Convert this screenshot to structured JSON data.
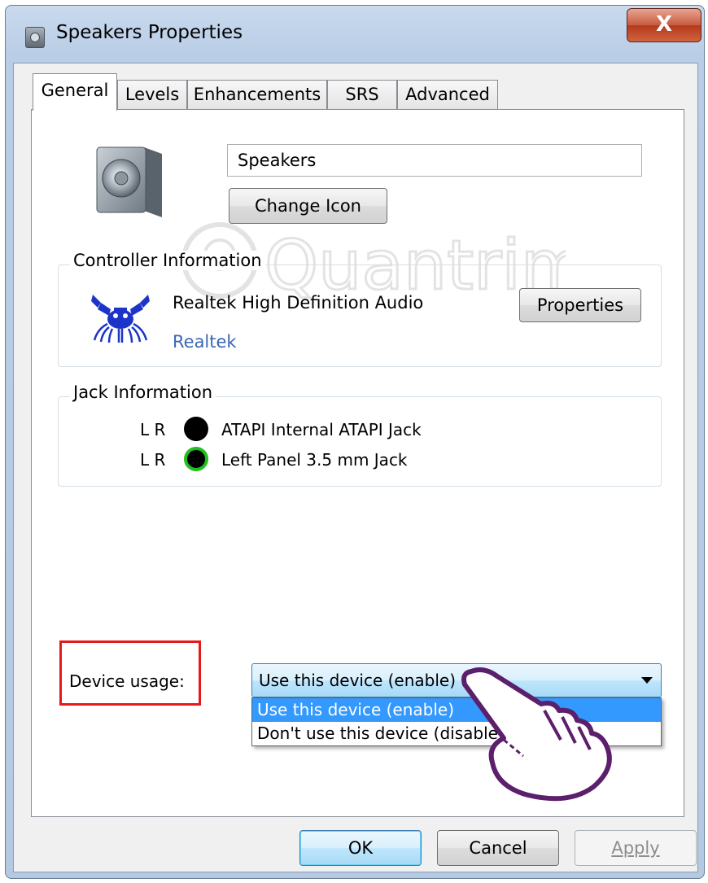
{
  "window": {
    "title": "Speakers Properties",
    "close_glyph": "X"
  },
  "tabs": [
    {
      "label": "General",
      "active": true
    },
    {
      "label": "Levels",
      "active": false
    },
    {
      "label": "Enhancements",
      "active": false
    },
    {
      "label": "SRS",
      "active": false
    },
    {
      "label": "Advanced",
      "active": false
    }
  ],
  "general": {
    "device_name": "Speakers",
    "change_icon_label": "Change Icon",
    "icon": "speaker-icon"
  },
  "controller": {
    "group_label": "Controller Information",
    "name": "Realtek High Definition Audio",
    "vendor_link": "Realtek",
    "properties_label": "Properties",
    "logo": "realtek-crab-logo"
  },
  "jack": {
    "group_label": "Jack Information",
    "items": [
      {
        "channels": "L R",
        "name": "ATAPI Internal ATAPI Jack",
        "color": "#000000"
      },
      {
        "channels": "L R",
        "name": "Left Panel 3.5 mm Jack",
        "color": "#21c021"
      }
    ]
  },
  "device_usage": {
    "label": "Device usage:",
    "selected": "Use this device (enable)",
    "options": [
      "Use this device (enable)",
      "Don't use this device (disable)"
    ]
  },
  "buttons": {
    "ok": "OK",
    "cancel": "Cancel",
    "apply": "Apply"
  },
  "watermark": "Quantrimang",
  "colors": {
    "highlight_border": "#e51a1a",
    "selection": "#3399ff",
    "link": "#3a67b6"
  }
}
